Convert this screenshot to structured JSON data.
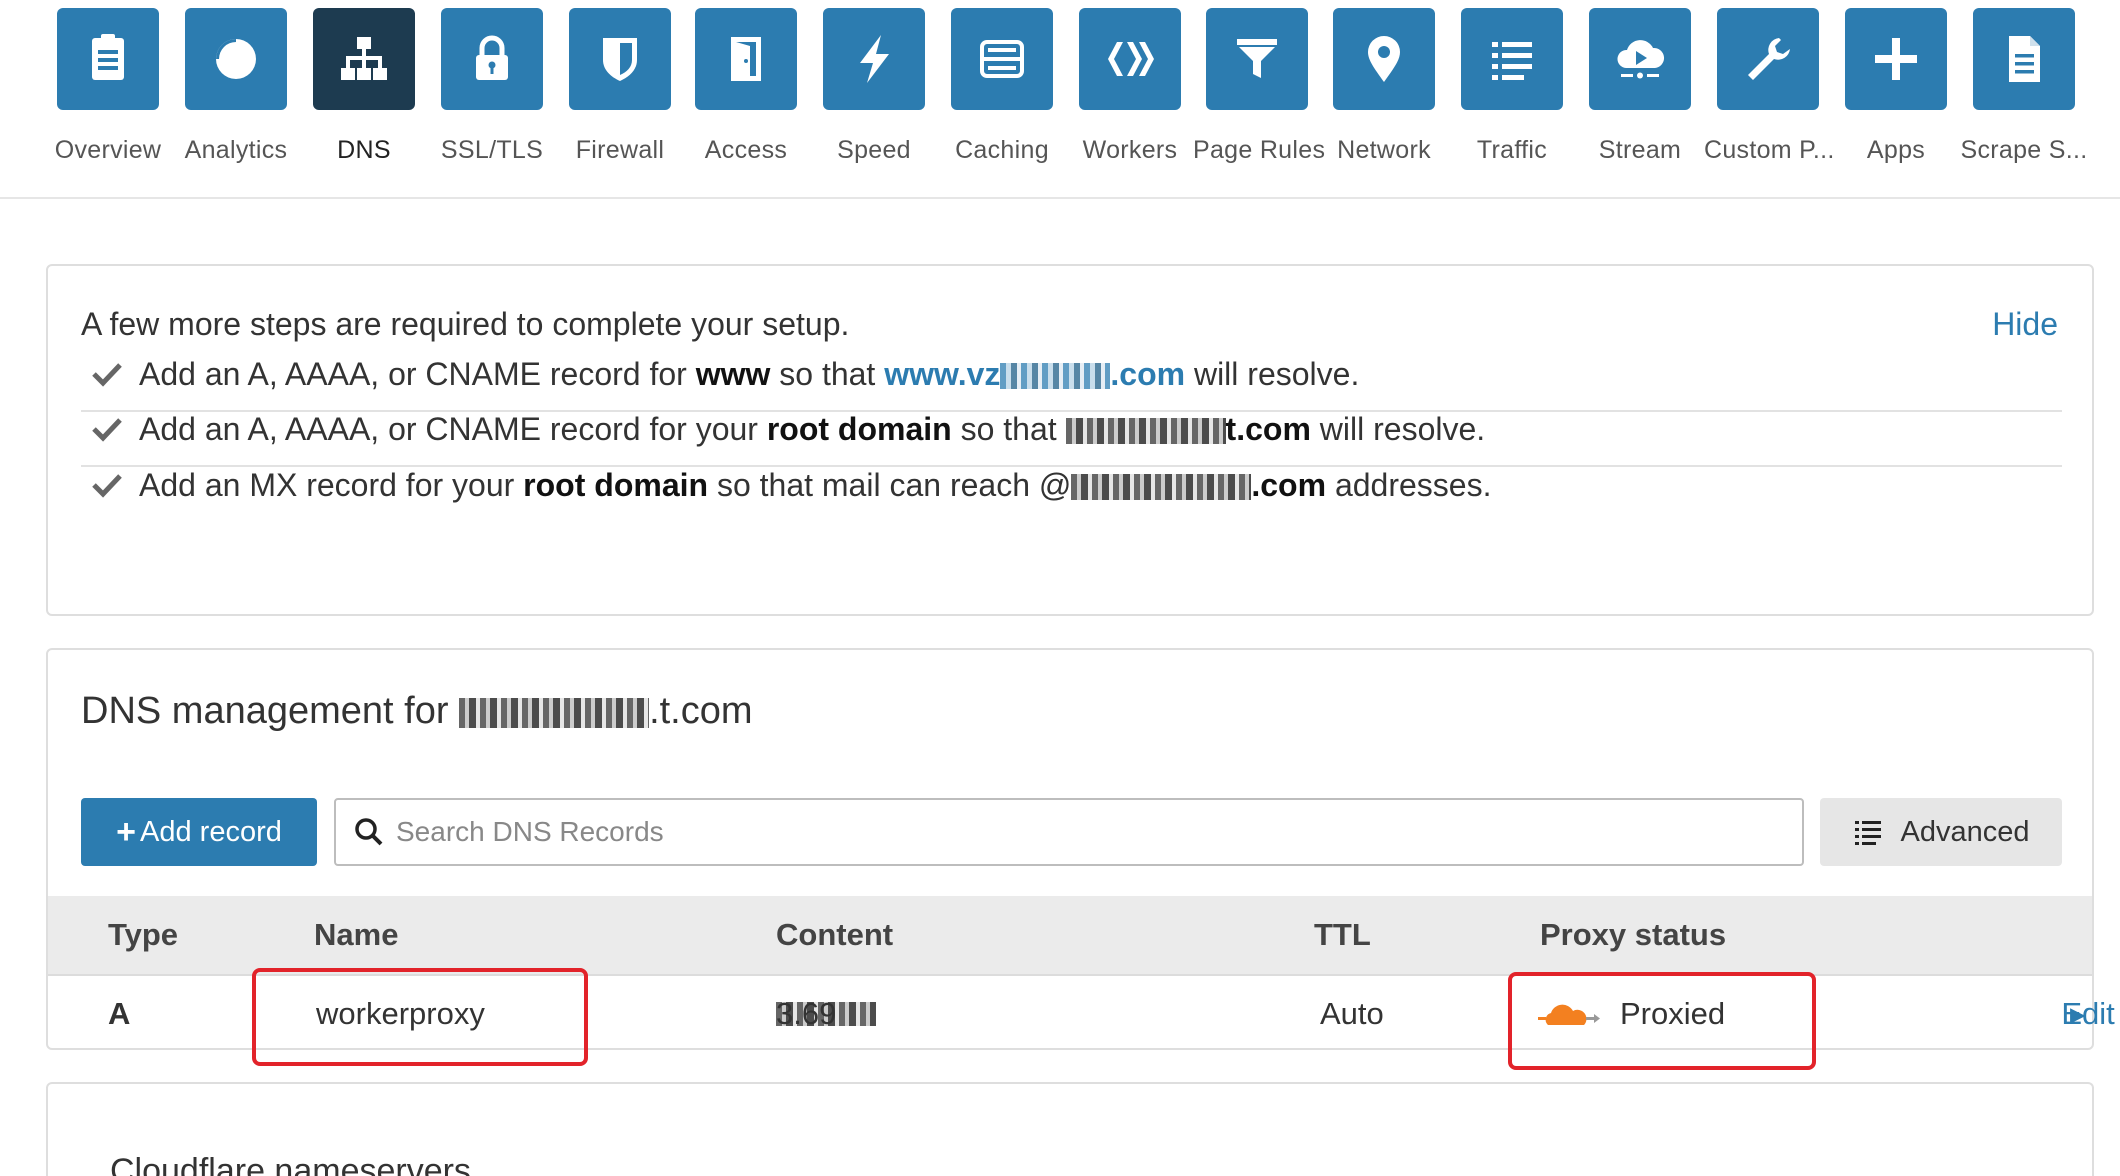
{
  "nav": {
    "items": [
      {
        "label": "Overview",
        "icon": "clipboard-icon",
        "active": false
      },
      {
        "label": "Analytics",
        "icon": "pie-chart-icon",
        "active": false
      },
      {
        "label": "DNS",
        "icon": "sitemap-icon",
        "active": true
      },
      {
        "label": "SSL/TLS",
        "icon": "lock-icon",
        "active": false
      },
      {
        "label": "Firewall",
        "icon": "shield-icon",
        "active": false
      },
      {
        "label": "Access",
        "icon": "door-icon",
        "active": false
      },
      {
        "label": "Speed",
        "icon": "lightning-icon",
        "active": false
      },
      {
        "label": "Caching",
        "icon": "server-icon",
        "active": false
      },
      {
        "label": "Workers",
        "icon": "workers-icon",
        "active": false
      },
      {
        "label": "Page Rules",
        "icon": "filter-icon",
        "active": false
      },
      {
        "label": "Network",
        "icon": "location-pin-icon",
        "active": false
      },
      {
        "label": "Traffic",
        "icon": "list-icon",
        "active": false
      },
      {
        "label": "Stream",
        "icon": "cloud-play-icon",
        "active": false
      },
      {
        "label": "Custom P...",
        "icon": "wrench-icon",
        "active": false
      },
      {
        "label": "Apps",
        "icon": "plus-icon",
        "active": false
      },
      {
        "label": "Scrape S...",
        "icon": "document-icon",
        "active": false
      }
    ],
    "tile_color": "#2c7cb0",
    "active_tile_color": "#1d3b50"
  },
  "setup": {
    "title": "A few more steps are required to complete your setup.",
    "hide_label": "Hide",
    "steps": [
      {
        "pre": "Add an A, AAAA, or CNAME record for ",
        "bold": "www",
        "mid": " so that ",
        "link_prefix": "www.vz",
        "link_suffix": ".com",
        "post": " will resolve."
      },
      {
        "pre": "Add an A, AAAA, or CNAME record for your ",
        "bold": "root domain",
        "mid": " so that ",
        "domain_suffix": "t.com",
        "post": " will resolve."
      },
      {
        "pre": "Add an MX record for your ",
        "bold": "root domain",
        "mid": " so that mail can reach @",
        "domain_suffix": ".com",
        "post": " addresses."
      }
    ]
  },
  "dns": {
    "title_prefix": "DNS management for ",
    "title_suffix": ".t.com",
    "add_label": "Add record",
    "search_placeholder": "Search DNS Records",
    "advanced_label": "Advanced",
    "columns": {
      "type": "Type",
      "name": "Name",
      "content": "Content",
      "ttl": "TTL",
      "proxy": "Proxy status"
    },
    "record": {
      "type": "A",
      "name": "workerproxy",
      "content_suffix": "3.69",
      "ttl": "Auto",
      "proxy": "Proxied",
      "edit": "Edit"
    }
  },
  "nameservers": {
    "title": "Cloudflare nameservers"
  },
  "colors": {
    "accent": "#2c7cb0",
    "highlight": "#e2232a",
    "proxy_orange": "#f38020"
  }
}
